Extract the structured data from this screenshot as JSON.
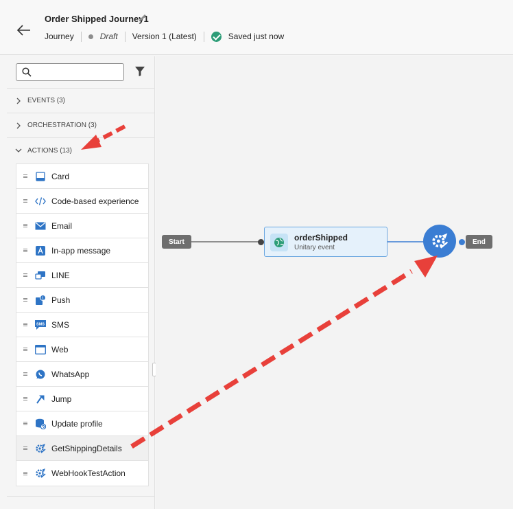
{
  "header": {
    "title": "Order Shipped Journey1",
    "type_label": "Journey",
    "status": "Draft",
    "version": "Version 1 (Latest)",
    "saved": "Saved just now"
  },
  "sidebar": {
    "search_placeholder": "",
    "categories": [
      {
        "label": "EVENTS (3)",
        "expanded": false
      },
      {
        "label": "ORCHESTRATION (3)",
        "expanded": false
      },
      {
        "label": "ACTIONS (13)",
        "expanded": true
      }
    ],
    "actions": [
      {
        "label": "Card",
        "icon": "card-icon"
      },
      {
        "label": "Code-based experience",
        "icon": "code-icon"
      },
      {
        "label": "Email",
        "icon": "email-icon"
      },
      {
        "label": "In-app message",
        "icon": "in-app-icon"
      },
      {
        "label": "LINE",
        "icon": "line-icon"
      },
      {
        "label": "Push",
        "icon": "push-icon"
      },
      {
        "label": "SMS",
        "icon": "sms-icon"
      },
      {
        "label": "Web",
        "icon": "web-icon"
      },
      {
        "label": "WhatsApp",
        "icon": "whatsapp-icon"
      },
      {
        "label": "Jump",
        "icon": "jump-icon"
      },
      {
        "label": "Update profile",
        "icon": "update-profile-icon"
      },
      {
        "label": "GetShippingDetails",
        "icon": "custom-action-icon"
      },
      {
        "label": "WebHookTestAction",
        "icon": "custom-action-icon"
      }
    ]
  },
  "canvas": {
    "start_label": "Start",
    "end_label": "End",
    "event_node": {
      "name": "orderShipped",
      "type": "Unitary event"
    }
  },
  "colors": {
    "accent": "#3a7dd3",
    "success": "#2d9d78",
    "annotation_arrow": "#e8403a"
  }
}
